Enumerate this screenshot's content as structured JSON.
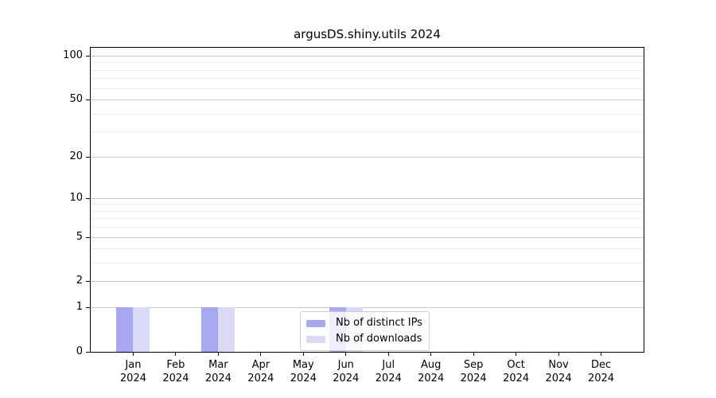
{
  "chart_data": {
    "type": "bar",
    "title": "argusDS.shiny.utils 2024",
    "categories": [
      "Jan",
      "Feb",
      "Mar",
      "Apr",
      "May",
      "Jun",
      "Jul",
      "Aug",
      "Sep",
      "Oct",
      "Nov",
      "Dec"
    ],
    "category_year": "2024",
    "series": [
      {
        "name": "Nb of distinct IPs",
        "color": "#a8a8f0",
        "values": [
          1,
          0,
          1,
          0,
          0,
          1,
          0,
          0,
          0,
          0,
          0,
          0
        ]
      },
      {
        "name": "Nb of downloads",
        "color": "#dadaf6",
        "values": [
          1,
          0,
          1,
          0,
          0,
          1,
          0,
          0,
          0,
          0,
          0,
          0
        ]
      }
    ],
    "xlabel": "",
    "ylabel": "",
    "y_scale": "log1p",
    "ylim": [
      0,
      115
    ],
    "y_major_ticks": [
      0,
      1,
      2,
      5,
      10,
      20,
      50,
      100
    ],
    "y_minor_ticks": [
      3,
      4,
      6,
      7,
      8,
      9,
      30,
      40,
      60,
      70,
      80,
      90
    ],
    "grid": true,
    "legend_position": "inside-bottom-center",
    "colors": {
      "grid_major": "#c9c9c9",
      "grid_minor": "#ececec",
      "axis": "#000000",
      "legend_border": "#cccccc",
      "background": "#ffffff"
    }
  }
}
